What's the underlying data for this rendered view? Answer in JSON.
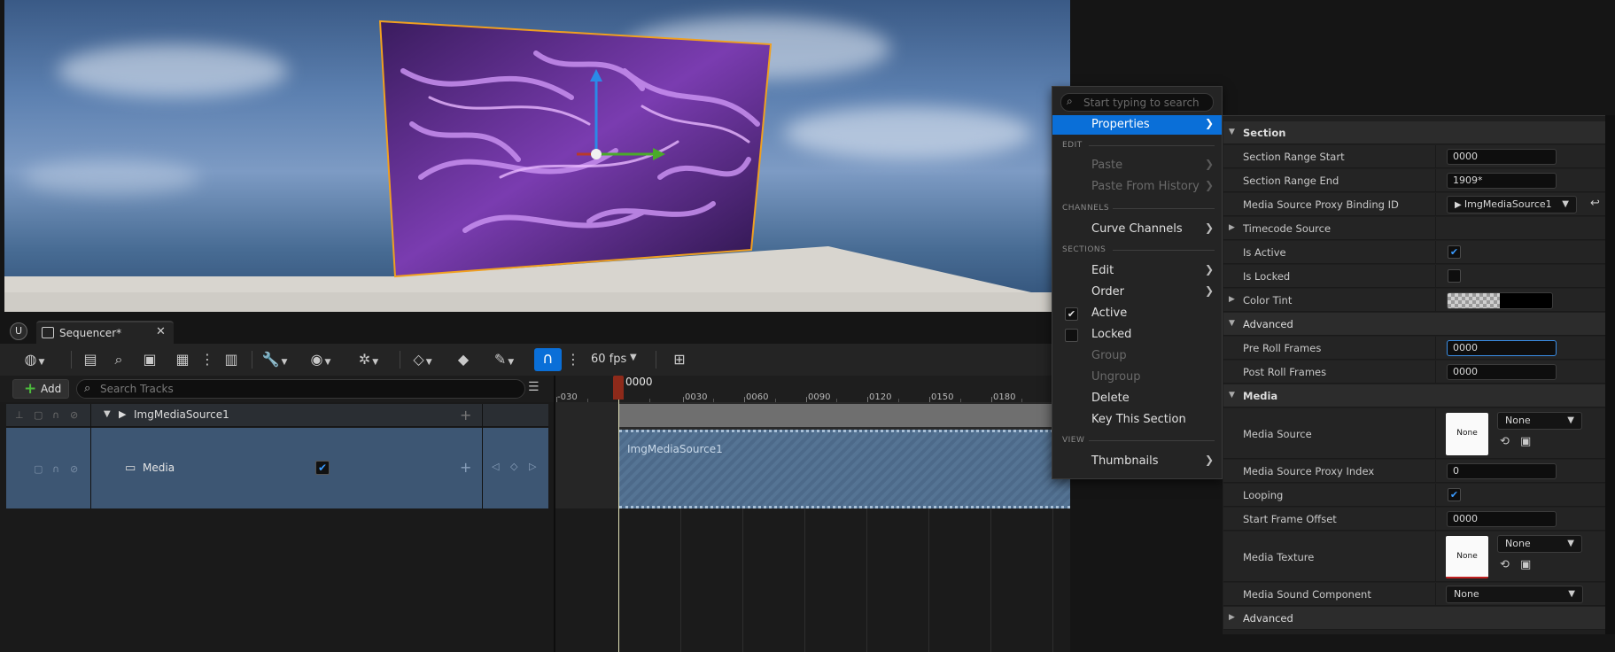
{
  "sequencer": {
    "tab_title": "Sequencer*",
    "fps": "60 fps",
    "add_label": "Add",
    "search_placeholder": "Search Tracks",
    "playhead": "0000",
    "ruler_ticks": [
      "-030",
      "0030",
      "0060",
      "0090",
      "0120",
      "0150",
      "0180"
    ],
    "object_track": "ImgMediaSource1",
    "media_track": "Media",
    "section_label": "ImgMediaSource1"
  },
  "context_menu": {
    "search_placeholder": "Start typing to search",
    "properties": "Properties",
    "edit_header": "EDIT",
    "paste": "Paste",
    "paste_history": "Paste From History",
    "channels_header": "CHANNELS",
    "curve_channels": "Curve Channels",
    "sections_header": "SECTIONS",
    "edit": "Edit",
    "order": "Order",
    "active": "Active",
    "locked": "Locked",
    "group": "Group",
    "ungroup": "Ungroup",
    "delete": "Delete",
    "key_section": "Key This Section",
    "view_header": "VIEW",
    "thumbnails": "Thumbnails"
  },
  "properties": {
    "section_cat": "Section",
    "range_start_label": "Section Range Start",
    "range_start_value": "0000",
    "range_end_label": "Section Range End",
    "range_end_value": "1909*",
    "proxy_binding_label": "Media Source Proxy Binding ID",
    "proxy_binding_value": "ImgMediaSource1",
    "timecode_label": "Timecode Source",
    "is_active_label": "Is Active",
    "is_locked_label": "Is Locked",
    "color_tint_label": "Color Tint",
    "advanced_cat": "Advanced",
    "pre_roll_label": "Pre Roll Frames",
    "pre_roll_value": "0000",
    "post_roll_label": "Post Roll Frames",
    "post_roll_value": "0000",
    "media_cat": "Media",
    "media_source_label": "Media Source",
    "media_source_thumb": "None",
    "media_source_value": "None",
    "proxy_index_label": "Media Source Proxy Index",
    "proxy_index_value": "0",
    "looping_label": "Looping",
    "start_offset_label": "Start Frame Offset",
    "start_offset_value": "0000",
    "media_texture_label": "Media Texture",
    "media_texture_thumb": "None",
    "media_texture_value": "None",
    "sound_label": "Media Sound Component",
    "sound_value": "None",
    "advanced2_cat": "Advanced"
  },
  "colors": {
    "accent": "#0a6fd8",
    "selection_outline": "#f0a020",
    "section_fill": "#4d6a8a"
  },
  "icons": [
    "engine-logo-icon",
    "clapboard-icon",
    "close-icon",
    "magnet-icon",
    "search-icon",
    "filter-icon",
    "checkmark-icon",
    "chevron-right-icon",
    "caret-down-icon",
    "reset-arrow-icon",
    "browse-icon",
    "tv-icon"
  ]
}
